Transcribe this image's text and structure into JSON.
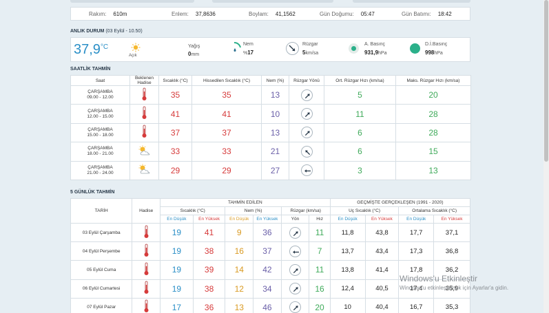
{
  "location_info": {
    "rakim_label": "Rakım:",
    "rakim_value": "610m",
    "enlem_label": "Enlem:",
    "enlem_value": "37,8636",
    "boylam_label": "Boylam:",
    "boylam_value": "41,1562",
    "gun_dogumu_label": "Gün Doğumu:",
    "gun_dogumu_value": "05:47",
    "gun_batimi_label": "Gün Batımı:",
    "gun_batimi_value": "18:42"
  },
  "current": {
    "section_title": "ANLIK DURUM",
    "section_sub": "(03 Eylül - 10.50)",
    "temp": "37,9",
    "temp_unit": "°C",
    "condition": "Açık",
    "condition_icon": "sun-icon",
    "rain_label": "Yağış",
    "rain_value": "0",
    "rain_unit": "mm",
    "humidity_label": "Nem",
    "humidity_prefix": "%",
    "humidity_value": "17",
    "wind_label": "Rüzgar",
    "wind_value": "5",
    "wind_unit": "km/sa",
    "pressure_label": "A. Basınç",
    "pressure_value": "931,9",
    "pressure_unit": "hPa",
    "sea_pressure_label": "D.İ.Basınç",
    "sea_pressure_value": "998",
    "sea_pressure_unit": "hPa",
    "colors": {
      "temp": "#2a8fc7",
      "pressure": "#2bb08a"
    }
  },
  "hourly": {
    "section_title": "SAATLİK TAHMİN",
    "headers": [
      "Saat",
      "Beklenen Hadise",
      "Sıcaklık (°C)",
      "Hissedilen Sıcaklık (°C)",
      "Nem (%)",
      "Rüzgar Yönü",
      "Ort. Rüzgar Hızı (km/sa)",
      "Maks. Rüzgar Hızı (km/sa)"
    ],
    "rows": [
      {
        "day": "ÇARŞAMBA",
        "time": "09.00 - 12.00",
        "icon": "thermometer-icon",
        "temp": "35",
        "feels": "35",
        "humidity": "13",
        "wind_dir": "ne",
        "avg_wind": "5",
        "max_wind": "20"
      },
      {
        "day": "ÇARŞAMBA",
        "time": "12.00 - 15.00",
        "icon": "thermometer-icon",
        "temp": "41",
        "feels": "41",
        "humidity": "10",
        "wind_dir": "ne",
        "avg_wind": "11",
        "max_wind": "28"
      },
      {
        "day": "ÇARŞAMBA",
        "time": "15.00 - 18.00",
        "icon": "thermometer-icon",
        "temp": "37",
        "feels": "37",
        "humidity": "13",
        "wind_dir": "ne",
        "avg_wind": "6",
        "max_wind": "28"
      },
      {
        "day": "ÇARŞAMBA",
        "time": "18.00 - 21.00",
        "icon": "partly-cloudy-icon",
        "temp": "33",
        "feels": "33",
        "humidity": "21",
        "wind_dir": "nw",
        "avg_wind": "6",
        "max_wind": "15"
      },
      {
        "day": "ÇARŞAMBA",
        "time": "21.00 - 24.00",
        "icon": "partly-cloudy-icon",
        "temp": "29",
        "feels": "29",
        "humidity": "27",
        "wind_dir": "w",
        "avg_wind": "3",
        "max_wind": "13"
      }
    ]
  },
  "daily": {
    "section_title": "5 GÜNLÜK TAHMİN",
    "h_tarih": "TARİH",
    "h_hadise": "Hadise",
    "h_tahmin": "TAHMİN EDİLEN",
    "h_gecmis": "GEÇMİŞTE GERÇEKLEŞEN (1991 - 2020)",
    "h_sicaklik": "Sıcaklık (°C)",
    "h_nem": "Nem (%)",
    "h_ruzgar": "Rüzgar (km/sa)",
    "h_uc": "Uç Sıcaklık (°C)",
    "h_ort": "Ortalama Sıcaklık (°C)",
    "h_en_dusuk": "En Düşük",
    "h_en_yuksek": "En Yüksek",
    "h_yon": "Yön",
    "h_hiz": "Hız",
    "rows": [
      {
        "date": "03 Eylül Çarşamba",
        "icon": "thermometer-icon",
        "tmin": "19",
        "tmax": "41",
        "hmin": "9",
        "hmax": "36",
        "wind_dir": "ne",
        "wind": "11",
        "umin": "11,8",
        "umax": "43,8",
        "omin": "17,7",
        "omax": "37,1"
      },
      {
        "date": "04 Eylül Perşembe",
        "icon": "thermometer-icon",
        "tmin": "19",
        "tmax": "38",
        "hmin": "16",
        "hmax": "37",
        "wind_dir": "w",
        "wind": "7",
        "umin": "13,7",
        "umax": "43,4",
        "omin": "17,3",
        "omax": "36,8"
      },
      {
        "date": "05 Eylül Cuma",
        "icon": "thermometer-icon",
        "tmin": "19",
        "tmax": "39",
        "hmin": "14",
        "hmax": "42",
        "wind_dir": "ne",
        "wind": "11",
        "umin": "13,8",
        "umax": "41,4",
        "omin": "17,8",
        "omax": "36,2"
      },
      {
        "date": "06 Eylül Cumartesi",
        "icon": "thermometer-icon",
        "tmin": "19",
        "tmax": "38",
        "hmin": "12",
        "hmax": "34",
        "wind_dir": "ne",
        "wind": "16",
        "umin": "12,4",
        "umax": "40,5",
        "omin": "17,4",
        "omax": "35,9"
      },
      {
        "date": "07 Eylül Pazar",
        "icon": "thermometer-icon",
        "tmin": "17",
        "tmax": "36",
        "hmin": "13",
        "hmax": "46",
        "wind_dir": "ne",
        "wind": "20",
        "umin": "10",
        "umax": "40,4",
        "omin": "16,7",
        "omax": "35,3"
      }
    ]
  },
  "watermark": {
    "line1": "Windows'u Etkinleştir",
    "line2": "Windows'u etkinleştirmek için Ayarlar'a gidin."
  }
}
